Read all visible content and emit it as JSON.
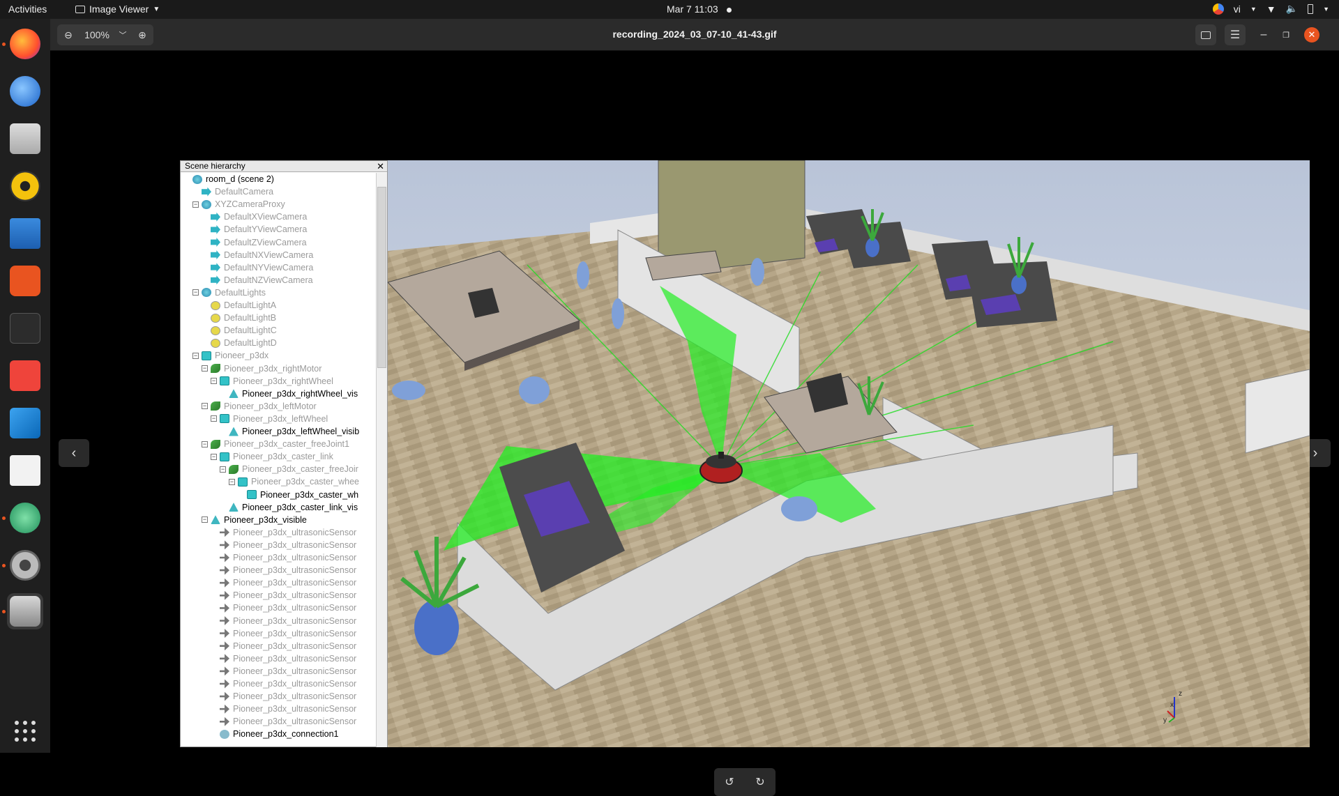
{
  "topbar": {
    "activities": "Activities",
    "app_name": "Image Viewer",
    "clock": "Mar 7  11:03",
    "input_lang": "vi"
  },
  "viewer": {
    "zoom_level": "100%",
    "title": "recording_2024_03_07-10_41-43.gif"
  },
  "hierarchy": {
    "title": "Scene hierarchy",
    "items": [
      {
        "label": "room_d (scene 2)",
        "icon": "globe",
        "toggle": "",
        "dim": false
      },
      {
        "label": "DefaultCamera",
        "icon": "camera",
        "toggle": "",
        "dim": true
      },
      {
        "label": "XYZCameraProxy",
        "icon": "globe",
        "toggle": "⊟",
        "dim": true
      },
      {
        "label": "DefaultXViewCamera",
        "icon": "camera",
        "toggle": "",
        "dim": true
      },
      {
        "label": "DefaultYViewCamera",
        "icon": "camera",
        "toggle": "",
        "dim": true
      },
      {
        "label": "DefaultZViewCamera",
        "icon": "camera",
        "toggle": "",
        "dim": true
      },
      {
        "label": "DefaultNXViewCamera",
        "icon": "camera",
        "toggle": "",
        "dim": true
      },
      {
        "label": "DefaultNYViewCamera",
        "icon": "camera",
        "toggle": "",
        "dim": true
      },
      {
        "label": "DefaultNZViewCamera",
        "icon": "camera",
        "toggle": "",
        "dim": true
      },
      {
        "label": "DefaultLights",
        "icon": "globe",
        "toggle": "⊟",
        "dim": true
      },
      {
        "label": "DefaultLightA",
        "icon": "light",
        "toggle": "",
        "dim": true
      },
      {
        "label": "DefaultLightB",
        "icon": "light",
        "toggle": "",
        "dim": true
      },
      {
        "label": "DefaultLightC",
        "icon": "light",
        "toggle": "",
        "dim": true
      },
      {
        "label": "DefaultLightD",
        "icon": "light",
        "toggle": "",
        "dim": true
      },
      {
        "label": "Pioneer_p3dx",
        "icon": "cube",
        "toggle": "⊟",
        "dim": true
      },
      {
        "label": "Pioneer_p3dx_rightMotor",
        "icon": "joint",
        "toggle": "⊟",
        "dim": true
      },
      {
        "label": "Pioneer_p3dx_rightWheel",
        "icon": "cube",
        "toggle": "⊟",
        "dim": true
      },
      {
        "label": "Pioneer_p3dx_rightWheel_vis",
        "icon": "shape",
        "toggle": "",
        "dim": false
      },
      {
        "label": "Pioneer_p3dx_leftMotor",
        "icon": "joint",
        "toggle": "⊟",
        "dim": true
      },
      {
        "label": "Pioneer_p3dx_leftWheel",
        "icon": "cube",
        "toggle": "⊟",
        "dim": true
      },
      {
        "label": "Pioneer_p3dx_leftWheel_visib",
        "icon": "shape",
        "toggle": "",
        "dim": false
      },
      {
        "label": "Pioneer_p3dx_caster_freeJoint1",
        "icon": "joint",
        "toggle": "⊟",
        "dim": true
      },
      {
        "label": "Pioneer_p3dx_caster_link",
        "icon": "cube",
        "toggle": "⊟",
        "dim": true
      },
      {
        "label": "Pioneer_p3dx_caster_freeJoir",
        "icon": "joint",
        "toggle": "⊟",
        "dim": true
      },
      {
        "label": "Pioneer_p3dx_caster_whee",
        "icon": "cube",
        "toggle": "⊟",
        "dim": true
      },
      {
        "label": "Pioneer_p3dx_caster_wh",
        "icon": "cube",
        "toggle": "",
        "dim": false
      },
      {
        "label": "Pioneer_p3dx_caster_link_vis",
        "icon": "shape",
        "toggle": "",
        "dim": false
      },
      {
        "label": "Pioneer_p3dx_visible",
        "icon": "shape",
        "toggle": "⊟",
        "dim": false
      },
      {
        "label": "Pioneer_p3dx_ultrasonicSensor",
        "icon": "sensor",
        "toggle": "",
        "dim": true
      },
      {
        "label": "Pioneer_p3dx_ultrasonicSensor",
        "icon": "sensor",
        "toggle": "",
        "dim": true
      },
      {
        "label": "Pioneer_p3dx_ultrasonicSensor",
        "icon": "sensor",
        "toggle": "",
        "dim": true
      },
      {
        "label": "Pioneer_p3dx_ultrasonicSensor",
        "icon": "sensor",
        "toggle": "",
        "dim": true
      },
      {
        "label": "Pioneer_p3dx_ultrasonicSensor",
        "icon": "sensor",
        "toggle": "",
        "dim": true
      },
      {
        "label": "Pioneer_p3dx_ultrasonicSensor",
        "icon": "sensor",
        "toggle": "",
        "dim": true
      },
      {
        "label": "Pioneer_p3dx_ultrasonicSensor",
        "icon": "sensor",
        "toggle": "",
        "dim": true
      },
      {
        "label": "Pioneer_p3dx_ultrasonicSensor",
        "icon": "sensor",
        "toggle": "",
        "dim": true
      },
      {
        "label": "Pioneer_p3dx_ultrasonicSensor",
        "icon": "sensor",
        "toggle": "",
        "dim": true
      },
      {
        "label": "Pioneer_p3dx_ultrasonicSensor",
        "icon": "sensor",
        "toggle": "",
        "dim": true
      },
      {
        "label": "Pioneer_p3dx_ultrasonicSensor",
        "icon": "sensor",
        "toggle": "",
        "dim": true
      },
      {
        "label": "Pioneer_p3dx_ultrasonicSensor",
        "icon": "sensor",
        "toggle": "",
        "dim": true
      },
      {
        "label": "Pioneer_p3dx_ultrasonicSensor",
        "icon": "sensor",
        "toggle": "",
        "dim": true
      },
      {
        "label": "Pioneer_p3dx_ultrasonicSensor",
        "icon": "sensor",
        "toggle": "",
        "dim": true
      },
      {
        "label": "Pioneer_p3dx_ultrasonicSensor",
        "icon": "sensor",
        "toggle": "",
        "dim": true
      },
      {
        "label": "Pioneer_p3dx_ultrasonicSensor",
        "icon": "sensor",
        "toggle": "",
        "dim": true
      },
      {
        "label": "Pioneer_p3dx_connection1",
        "icon": "dummy",
        "toggle": "",
        "dim": false
      }
    ]
  },
  "scene_axes": {
    "x": "x",
    "y": "y",
    "z": "z"
  },
  "colors": {
    "accent": "#e95420",
    "laser": "#22ee22",
    "floor": "#b8a888",
    "wall": "#e4e4e4",
    "close_button": "#e95420"
  }
}
